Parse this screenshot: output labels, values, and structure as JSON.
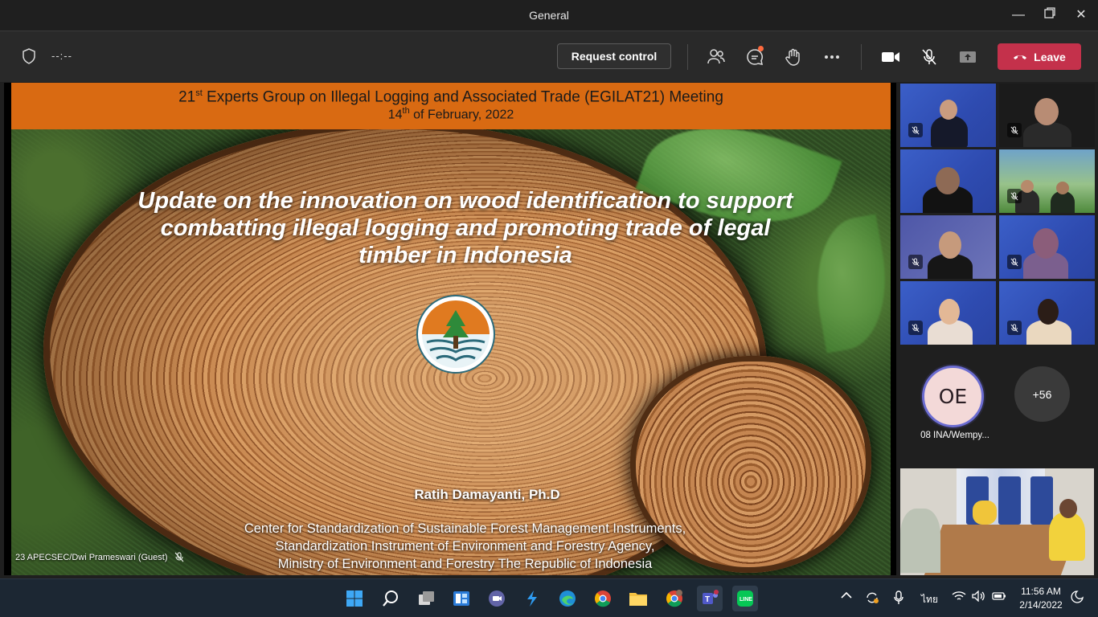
{
  "window": {
    "title": "General"
  },
  "toolbar": {
    "timer": "--:--",
    "request_control_label": "Request control",
    "leave_label": "Leave"
  },
  "slide": {
    "banner_line1_prefix": "21",
    "banner_line1_sup": "st",
    "banner_line1_rest": " Experts Group on Illegal Logging and Associated Trade (EGILAT21) Meeting",
    "banner_line2_prefix": "14",
    "banner_line2_sup": "th",
    "banner_line2_rest": " of February, 2022",
    "title_line1": "Update on the innovation on wood identification to support",
    "title_line2": "combatting illegal logging and promoting trade of legal",
    "title_line3": "timber in Indonesia",
    "author": "Ratih Damayanti, Ph.D",
    "affiliation_line1": "Center for Standardization of Sustainable Forest Management Instruments,",
    "affiliation_line2": "Standardization Instrument of Environment and Forestry Agency,",
    "affiliation_line3": "Ministry of Environment and Forestry The Republic of Indonesia"
  },
  "presenter": {
    "name": "23 APECSEC/Dwi Prameswari (Guest)"
  },
  "participants": {
    "avatar_initials": "OE",
    "avatar_name": "08 INA/Wempy...",
    "more_count": "+56"
  },
  "taskbar": {
    "lang": "ไทย",
    "time": "11:56 AM",
    "date": "2/14/2022"
  },
  "colors": {
    "leave": "#c4314b",
    "banner": "#d96a12",
    "accent": "#6b6cd1"
  }
}
